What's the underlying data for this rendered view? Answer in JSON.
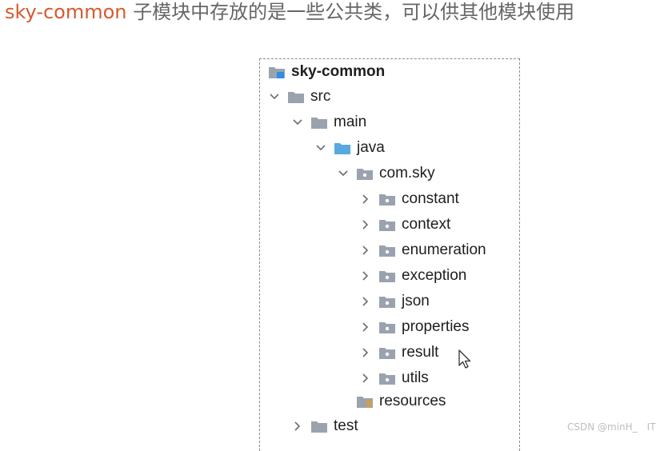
{
  "heading": {
    "accent_text": "sky-common",
    "rest_text": " 子模块中存放的是一些公共类，可以供其他模块使用"
  },
  "colors": {
    "accent": "#d65a2e",
    "folder_gray": "#9aa3ad",
    "folder_blue": "#5aa8e0",
    "module_badge": "#2d8ee6",
    "resources_badge": "#e0a030"
  },
  "tree": {
    "items": [
      {
        "label": "sky-common",
        "icon": "module-folder-icon",
        "expanded": true,
        "level": 0
      },
      {
        "label": "src",
        "icon": "folder-icon",
        "expanded": true,
        "level": 1
      },
      {
        "label": "main",
        "icon": "folder-icon",
        "expanded": true,
        "level": 2
      },
      {
        "label": "java",
        "icon": "source-root-folder-icon",
        "expanded": true,
        "level": 3
      },
      {
        "label": "com.sky",
        "icon": "package-icon",
        "expanded": true,
        "level": 4
      },
      {
        "label": "constant",
        "icon": "package-icon",
        "expanded": false,
        "level": 5
      },
      {
        "label": "context",
        "icon": "package-icon",
        "expanded": false,
        "level": 5
      },
      {
        "label": "enumeration",
        "icon": "package-icon",
        "expanded": false,
        "level": 5
      },
      {
        "label": "exception",
        "icon": "package-icon",
        "expanded": false,
        "level": 5
      },
      {
        "label": "json",
        "icon": "package-icon",
        "expanded": false,
        "level": 5
      },
      {
        "label": "properties",
        "icon": "package-icon",
        "expanded": false,
        "level": 5
      },
      {
        "label": "result",
        "icon": "package-icon",
        "expanded": false,
        "level": 5
      },
      {
        "label": "utils",
        "icon": "package-icon",
        "expanded": false,
        "level": 5
      },
      {
        "label": "resources",
        "icon": "resources-folder-icon",
        "expanded": null,
        "level": 4
      },
      {
        "label": "test",
        "icon": "folder-icon",
        "expanded": false,
        "level": 2
      }
    ]
  },
  "watermark": "CSDN @minH_　IT"
}
